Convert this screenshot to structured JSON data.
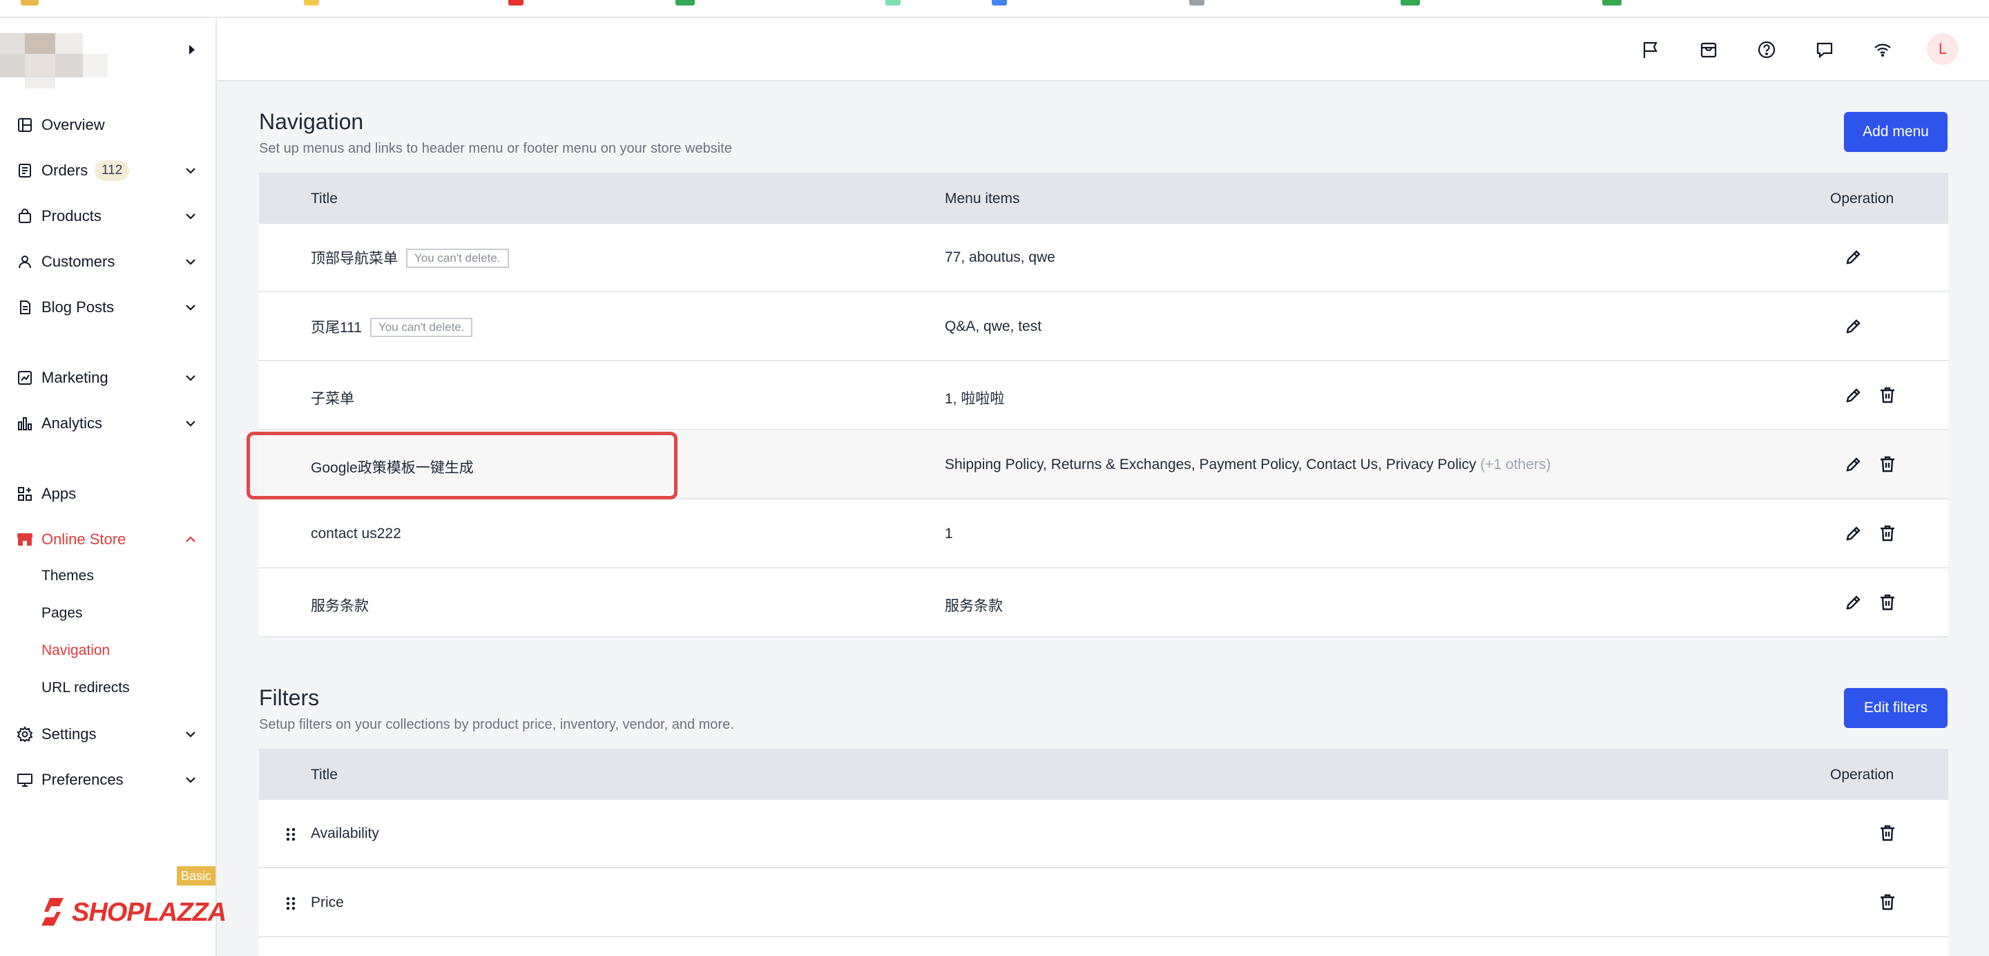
{
  "sidebar": {
    "items": [
      {
        "label": "Overview"
      },
      {
        "label": "Orders",
        "badge": "112"
      },
      {
        "label": "Products"
      },
      {
        "label": "Customers"
      },
      {
        "label": "Blog Posts"
      },
      {
        "label": "Marketing"
      },
      {
        "label": "Analytics"
      },
      {
        "label": "Apps"
      },
      {
        "label": "Online Store"
      },
      {
        "label": "Settings"
      },
      {
        "label": "Preferences"
      }
    ],
    "online_store_sub": [
      {
        "label": "Themes"
      },
      {
        "label": "Pages"
      },
      {
        "label": "Navigation"
      },
      {
        "label": "URL redirects"
      }
    ],
    "brand": {
      "name": "SHOPLAZZA",
      "plan": "Basic"
    }
  },
  "header": {
    "icons": [
      "flag-icon",
      "store-icon",
      "help-icon",
      "message-icon",
      "wifi-icon"
    ],
    "avatar_initial": "L"
  },
  "navigation": {
    "title": "Navigation",
    "subtitle": "Set up menus and links to header menu or footer menu on your store website",
    "add_button": "Add menu",
    "columns": [
      "Title",
      "Menu items",
      "Operation"
    ],
    "rows": [
      {
        "title": "顶部导航菜单",
        "tag": "You can't delete.",
        "items": "77, aboutus, qwe",
        "extra": ""
      },
      {
        "title": "页尾111",
        "tag": "You can't delete.",
        "items": "Q&A, qwe, test",
        "extra": ""
      },
      {
        "title": "子菜单",
        "tag": "",
        "items": "1, 啦啦啦",
        "extra": ""
      },
      {
        "title": "Google政策模板一键生成",
        "tag": "",
        "items": "Shipping Policy, Returns & Exchanges, Payment Policy, Contact Us, Privacy Policy",
        "extra": "(+1 others)"
      },
      {
        "title": "contact us222",
        "tag": "",
        "items": "1",
        "extra": ""
      },
      {
        "title": "服务条款",
        "tag": "",
        "items": "服务条款",
        "extra": ""
      }
    ]
  },
  "filters": {
    "title": "Filters",
    "subtitle": "Setup filters on your collections by product price, inventory, vendor, and more.",
    "edit_button": "Edit filters",
    "columns": [
      "Title",
      "Operation"
    ],
    "rows": [
      {
        "title": "Availability"
      },
      {
        "title": "Price"
      }
    ]
  },
  "colors": {
    "accent_red": "#e03b3b",
    "primary_blue": "#2f54eb",
    "highlight_box": "#e04848",
    "brand_badge": "#e8b84a"
  }
}
